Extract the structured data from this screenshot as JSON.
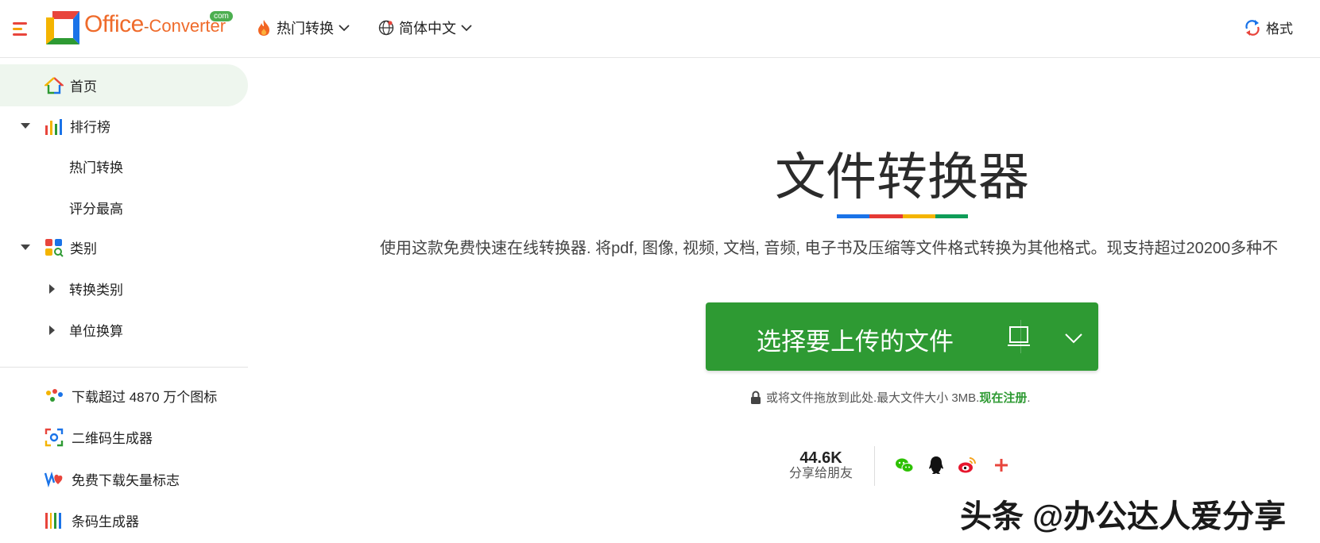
{
  "header": {
    "logo": {
      "office": "Office",
      "dash": "-",
      "converter": "Converter",
      "com": "com"
    },
    "nav": [
      {
        "label": "热门转换",
        "icon": "fire-icon"
      },
      {
        "label": "简体中文",
        "icon": "globe-icon"
      }
    ],
    "right": {
      "label": "格式",
      "icon": "convert-arrows-icon"
    }
  },
  "sidebar": {
    "home": "首页",
    "ranking": {
      "label": "排行榜",
      "children": [
        "热门转换",
        "评分最高"
      ]
    },
    "category": {
      "label": "类别",
      "children": [
        "转换类别",
        "单位换算"
      ]
    },
    "links": [
      {
        "label": "下载超过 4870 万个图标",
        "icon": "dots-icon"
      },
      {
        "label": "二维码生成器",
        "icon": "qr-scan-icon"
      },
      {
        "label": "免费下载矢量标志",
        "icon": "heart-logo-icon"
      },
      {
        "label": "条码生成器",
        "icon": "barcode-icon"
      }
    ]
  },
  "main": {
    "title": "文件转换器",
    "title_bar_colors": [
      "#1a73e8",
      "#e53935",
      "#f4b400",
      "#0f9d58"
    ],
    "subtitle": "使用这款免费快速在线转换器. 将pdf, 图像, 视频, 文档, 音频, 电子书及压缩等文件格式转换为其他格式。现支持超过20200多种不",
    "upload": {
      "label": "选择要上传的文件"
    },
    "note": {
      "text": "或将文件拖放到此处.最大文件大小 3MB.",
      "register": "现在注册",
      "suffix": "."
    },
    "share": {
      "count": "44.6K",
      "label": "分享给朋友"
    }
  },
  "watermark": "头条 @办公达人爱分享",
  "colors": {
    "accent_green": "#2e9a33",
    "logo_orange": "#ef6b2b"
  }
}
